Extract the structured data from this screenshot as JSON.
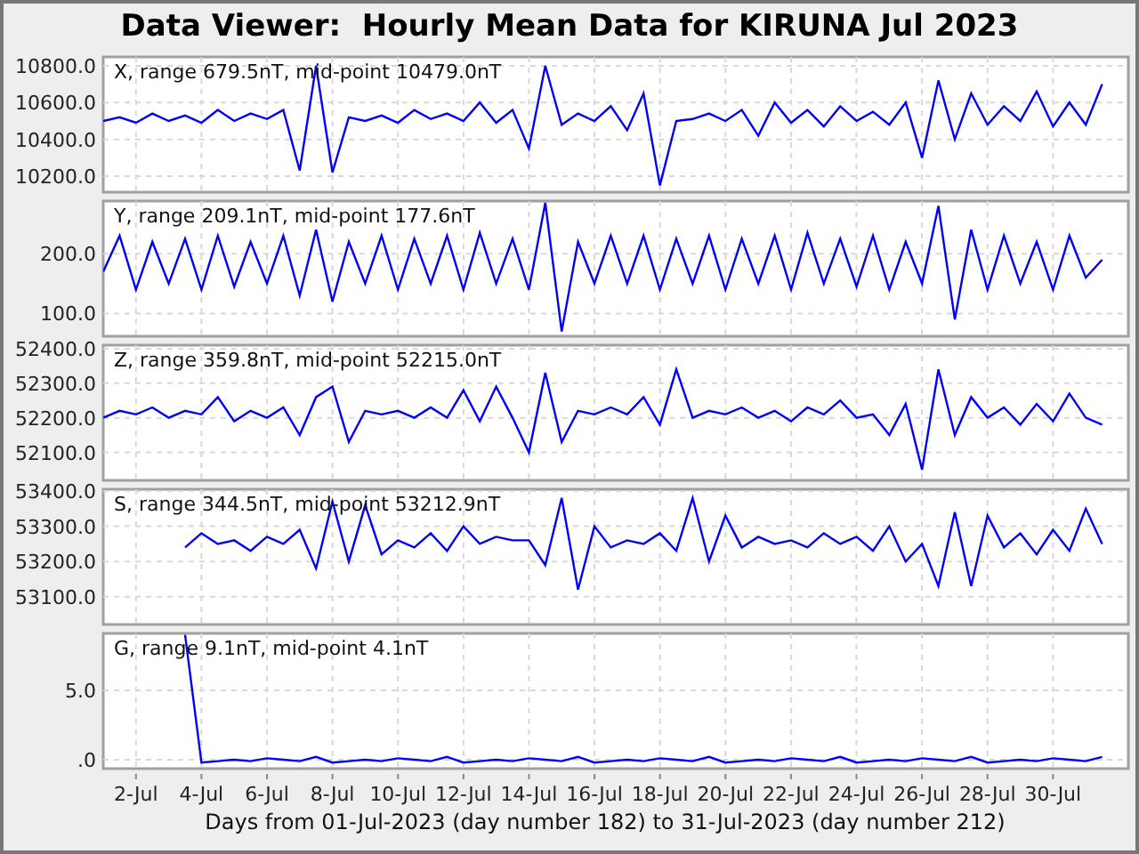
{
  "title": "Data Viewer:  Hourly Mean Data for KIRUNA Jul 2023",
  "panels": [
    {
      "label": "X, range 679.5nT, mid-point 10479.0nT",
      "chart_data": {
        "type": "line",
        "grid": true,
        "ylim": [
          10113,
          10848
        ],
        "yticks": [
          {
            "value": 10200,
            "label": "10200.0"
          },
          {
            "value": 10400,
            "label": "10400.0"
          },
          {
            "value": 10600,
            "label": "10600.0"
          },
          {
            "value": 10800,
            "label": "10800.0"
          }
        ],
        "series": [
          {
            "color": "#0000ff",
            "values": [
              10500,
              10520,
              10490,
              10540,
              10500,
              10530,
              10490,
              10560,
              10500,
              10540,
              10510,
              10560,
              10230,
              10800,
              10220,
              10520,
              10500,
              10530,
              10490,
              10560,
              10510,
              10540,
              10500,
              10600,
              10490,
              10560,
              10350,
              10800,
              10480,
              10540,
              10500,
              10580,
              10450,
              10650,
              10150,
              10500,
              10510,
              10540,
              10500,
              10560,
              10420,
              10600,
              10490,
              10560,
              10470,
              10580,
              10500,
              10550,
              10480,
              10600,
              10300,
              10720,
              10400,
              10650,
              10480,
              10580,
              10500,
              10660,
              10470,
              10600,
              10480,
              10700
            ]
          }
        ]
      }
    },
    {
      "label": "Y, range 209.1nT, mid-point 177.6nT",
      "chart_data": {
        "type": "line",
        "grid": true,
        "ylim": [
          62,
          288
        ],
        "yticks": [
          {
            "value": 100,
            "label": "100.0"
          },
          {
            "value": 200,
            "label": "200.0"
          }
        ],
        "series": [
          {
            "color": "#0000ff",
            "values": [
              170,
              230,
              140,
              220,
              150,
              225,
              140,
              230,
              145,
              220,
              150,
              230,
              130,
              240,
              120,
              220,
              150,
              230,
              140,
              225,
              150,
              230,
              140,
              235,
              150,
              225,
              140,
              285,
              70,
              220,
              150,
              230,
              150,
              230,
              140,
              225,
              150,
              230,
              140,
              225,
              150,
              230,
              140,
              235,
              150,
              225,
              145,
              230,
              140,
              220,
              150,
              280,
              90,
              240,
              140,
              230,
              150,
              220,
              140,
              230,
              160,
              190
            ]
          }
        ]
      }
    },
    {
      "label": "Z, range 359.8nT, mid-point 52215.0nT",
      "chart_data": {
        "type": "line",
        "grid": true,
        "ylim": [
          52019,
          52410
        ],
        "yticks": [
          {
            "value": 52100,
            "label": "52100.0"
          },
          {
            "value": 52200,
            "label": "52200.0"
          },
          {
            "value": 52300,
            "label": "52300.0"
          },
          {
            "value": 52400,
            "label": "52400.0"
          }
        ],
        "series": [
          {
            "color": "#0000ff",
            "values": [
              52200,
              52220,
              52210,
              52230,
              52200,
              52220,
              52210,
              52260,
              52190,
              52220,
              52200,
              52230,
              52150,
              52260,
              52290,
              52130,
              52220,
              52210,
              52220,
              52200,
              52230,
              52200,
              52280,
              52190,
              52290,
              52200,
              52100,
              52330,
              52130,
              52220,
              52210,
              52230,
              52210,
              52260,
              52180,
              52340,
              52200,
              52220,
              52210,
              52230,
              52200,
              52220,
              52190,
              52230,
              52210,
              52250,
              52200,
              52210,
              52150,
              52240,
              52050,
              52340,
              52150,
              52260,
              52200,
              52230,
              52180,
              52240,
              52190,
              52270,
              52200,
              52180
            ]
          }
        ]
      }
    },
    {
      "label": "S, range 344.5nT, mid-point 53212.9nT",
      "chart_data": {
        "type": "line",
        "grid": true,
        "ylim": [
          53021,
          53405
        ],
        "yticks": [
          {
            "value": 53100,
            "label": "53100.0"
          },
          {
            "value": 53200,
            "label": "53200.0"
          },
          {
            "value": 53300,
            "label": "53300.0"
          },
          {
            "value": 53400,
            "label": "53400.0"
          }
        ],
        "series": [
          {
            "color": "#0000ff",
            "values": [
              null,
              null,
              null,
              null,
              null,
              53240,
              53280,
              53250,
              53260,
              53230,
              53270,
              53250,
              53290,
              53180,
              53370,
              53200,
              53360,
              53220,
              53260,
              53240,
              53280,
              53230,
              53300,
              53250,
              53270,
              53260,
              53260,
              53190,
              53380,
              53120,
              53300,
              53240,
              53260,
              53250,
              53280,
              53230,
              53380,
              53200,
              53330,
              53240,
              53270,
              53250,
              53260,
              53240,
              53280,
              53250,
              53270,
              53230,
              53300,
              53200,
              53250,
              53130,
              53340,
              53130,
              53330,
              53240,
              53280,
              53220,
              53290,
              53230,
              53350,
              53250
            ]
          }
        ]
      }
    },
    {
      "label": "G, range 9.1nT, mid-point 4.1nT",
      "chart_data": {
        "type": "line",
        "grid": true,
        "xlabel": "Days from 01-Jul-2023 (day number 182) to 31-Jul-2023 (day number 212)",
        "ylim": [
          -0.64,
          9.1
        ],
        "yticks": [
          {
            "value": 0,
            "label": ".0"
          },
          {
            "value": 5,
            "label": "5.0"
          }
        ],
        "categories": [
          null,
          null,
          "2-Jul",
          null,
          null,
          null,
          "4-Jul",
          null,
          null,
          null,
          "6-Jul",
          null,
          null,
          null,
          "8-Jul",
          null,
          null,
          null,
          "10-Jul",
          null,
          null,
          null,
          "12-Jul",
          null,
          null,
          null,
          "14-Jul",
          null,
          null,
          null,
          "16-Jul",
          null,
          null,
          null,
          "18-Jul",
          null,
          null,
          null,
          "20-Jul",
          null,
          null,
          null,
          "22-Jul",
          null,
          null,
          null,
          "24-Jul",
          null,
          null,
          null,
          "26-Jul",
          null,
          null,
          null,
          "28-Jul",
          null,
          null,
          null,
          "30-Jul",
          null,
          null,
          null
        ],
        "series": [
          {
            "color": "#0000ff",
            "values": [
              null,
              null,
              null,
              null,
              null,
              9.0,
              -0.2,
              -0.1,
              0.0,
              -0.1,
              0.1,
              0.0,
              -0.1,
              0.2,
              -0.2,
              -0.1,
              0.0,
              -0.1,
              0.1,
              0.0,
              -0.1,
              0.2,
              -0.2,
              -0.1,
              0.0,
              -0.1,
              0.1,
              0.0,
              -0.1,
              0.2,
              -0.2,
              -0.1,
              0.0,
              -0.1,
              0.1,
              0.0,
              -0.1,
              0.2,
              -0.2,
              -0.1,
              0.0,
              -0.1,
              0.1,
              0.0,
              -0.1,
              0.2,
              -0.2,
              -0.1,
              0.0,
              -0.1,
              0.1,
              0.0,
              -0.1,
              0.2,
              -0.2,
              -0.1,
              0.0,
              -0.1,
              0.1,
              0.0,
              -0.1,
              0.2
            ]
          }
        ]
      }
    }
  ]
}
